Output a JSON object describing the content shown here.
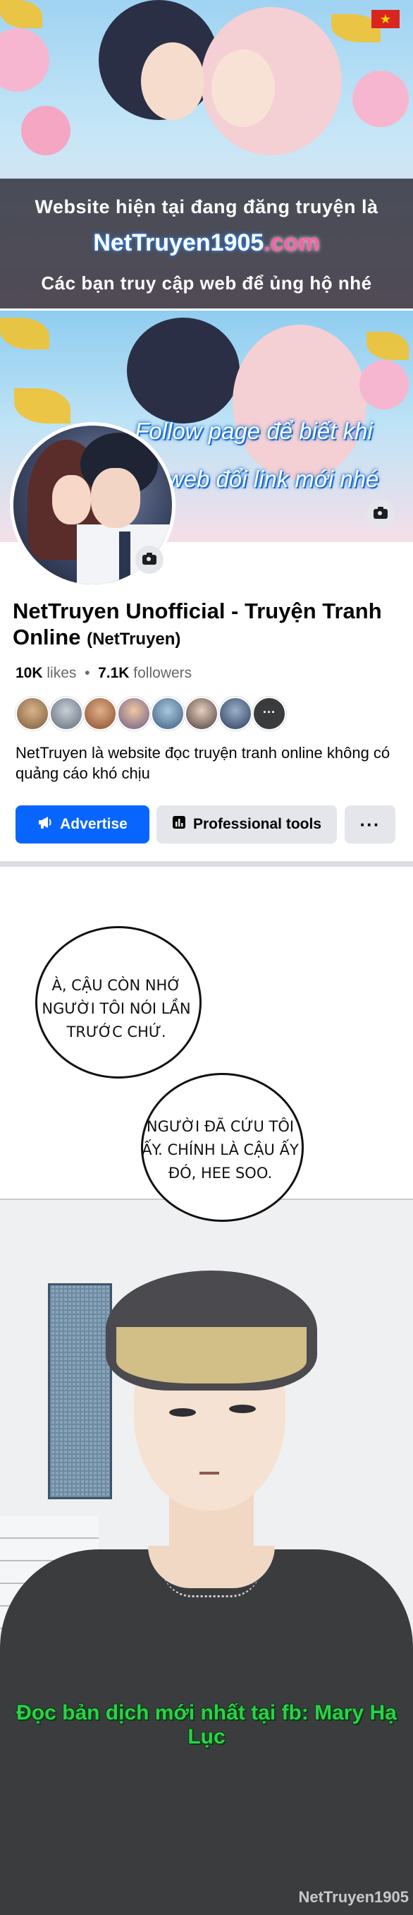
{
  "banner": {
    "line1": "Website hiện tại đang đăng truyện là",
    "site_part1": "NetTruyen1905",
    "site_part2": ".com",
    "line2": "Các bạn truy cập web để ủng hộ nhé",
    "flag_star": "★"
  },
  "cover": {
    "text_line1": "Follow page để biết khi",
    "text_line2": "nào web đổi link mới nhé"
  },
  "page": {
    "name": "NetTruyen Unofficial - Truyện Tranh Online",
    "handle": "(NetTruyen)",
    "likes_count": "10K",
    "likes_label": "likes",
    "separator": "•",
    "followers_count": "7.1K",
    "followers_label": "followers",
    "about": "NetTruyen là website đọc truyện tranh online không có quảng cáo khó chịu",
    "more_friends_icon": "···"
  },
  "buttons": {
    "advertise": "Advertise",
    "professional_tools": "Professional tools",
    "more": "···"
  },
  "comic": {
    "bubble1": "À, CẬU CÒN NHỚ NGƯỜI TÔI NÓI LẦN TRƯỚC CHỨ.",
    "bubble2": "NGƯỜI ĐÃ CỨU TÔI ẤY. CHÍNH LÀ CẬU ẤY ĐÓ, HEE SOO.",
    "credit": "Đọc bản dịch mới nhất tại fb: Mary Hạ Lục",
    "watermark": "NetTruyen1905"
  },
  "colors": {
    "facebook_blue": "#0866ff",
    "button_grey": "#e4e6eb",
    "credit_green": "#2bd14a"
  }
}
